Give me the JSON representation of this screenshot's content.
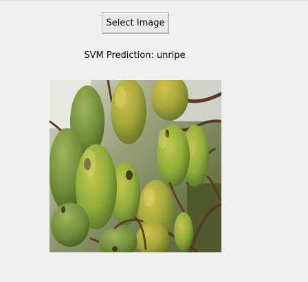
{
  "select_button": {
    "label": "Select Image"
  },
  "prediction": {
    "text": "SVM Prediction: unripe"
  },
  "image": {
    "subject": "cluster of green mangoes on a tree"
  },
  "colors": {
    "window_bg": "#f0f0f0",
    "mango_green": "#7ea134",
    "mango_yellow": "#b7b23a",
    "branch_brown": "#5a3a24",
    "foliage_dark": "#3c4e22"
  }
}
